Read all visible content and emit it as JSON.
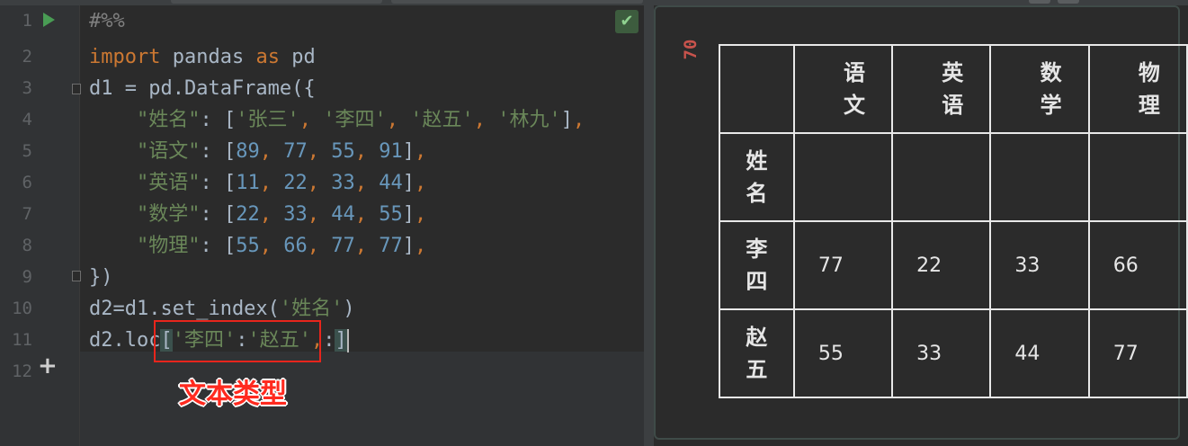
{
  "editor": {
    "lines": [
      {
        "n": "1"
      },
      {
        "n": "2"
      },
      {
        "n": "3"
      },
      {
        "n": "4"
      },
      {
        "n": "5"
      },
      {
        "n": "6"
      },
      {
        "n": "7"
      },
      {
        "n": "8"
      },
      {
        "n": "9"
      },
      {
        "n": "10"
      },
      {
        "n": "11"
      },
      {
        "n": "12"
      }
    ],
    "code": {
      "l1": "#%%",
      "l2_kw1": "import",
      "l2_mid": " pandas ",
      "l2_kw2": "as",
      "l2_end": " pd",
      "l3": "d1 = pd.DataFrame({",
      "l4_key": "\"姓名\"",
      "l4_rest_a": ": [",
      "l4_s1": "'张三'",
      "l4_s2": "'李四'",
      "l4_s3": "'赵五'",
      "l4_s4": "'林九'",
      "l5_key": "\"语文\"",
      "l5_vals": [
        "89",
        "77",
        "55",
        "91"
      ],
      "l6_key": "\"英语\"",
      "l6_vals": [
        "11",
        "22",
        "33",
        "44"
      ],
      "l7_key": "\"数学\"",
      "l7_vals": [
        "22",
        "33",
        "44",
        "55"
      ],
      "l8_key": "\"物理\"",
      "l8_vals": [
        "55",
        "66",
        "77",
        "77"
      ],
      "l9": "})",
      "l10_a": "d2=d1.set_index(",
      "l10_s": "'姓名'",
      "l10_b": ")",
      "l11_a": "d2.loc",
      "l11_s1": "'李四'",
      "l11_s2": "'赵五'",
      "l11_tail": ":"
    },
    "annotation": "文本类型"
  },
  "output": {
    "exec_count": "70",
    "columns": [
      "语文",
      "英语",
      "数学",
      "物理"
    ],
    "index_name": "姓名",
    "rows": [
      {
        "index": "李四",
        "values": [
          "77",
          "22",
          "33",
          "66"
        ]
      },
      {
        "index": "赵五",
        "values": [
          "55",
          "33",
          "44",
          "77"
        ]
      }
    ]
  }
}
